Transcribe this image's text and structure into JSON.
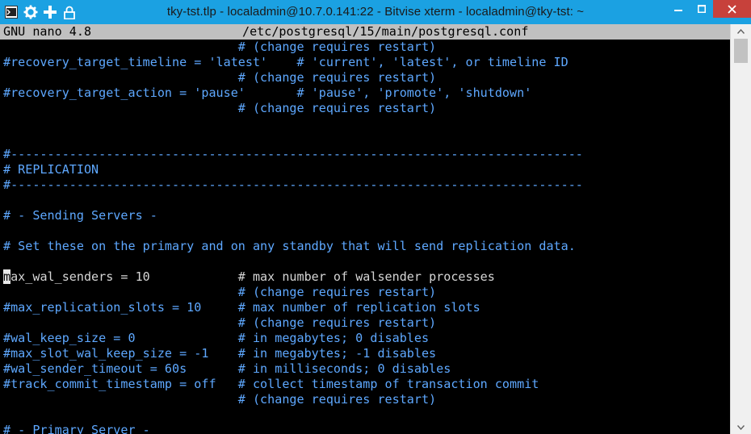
{
  "window": {
    "title": "tky-tst.tlp - localadmin@10.7.0.141:22 - Bitvise xterm - localadmin@tky-tst: ~",
    "icons": [
      "terminal-app-icon",
      "gear-icon",
      "plus-icon",
      "lock-icon"
    ],
    "controls": [
      "minimize",
      "maximize",
      "close"
    ]
  },
  "nano": {
    "version": "GNU nano 4.8",
    "filename": "/etc/postgresql/15/main/postgresql.conf"
  },
  "lines": [
    {
      "text": "                                # (change requires restart)",
      "kind": "comment"
    },
    {
      "text": "#recovery_target_timeline = 'latest'    # 'current', 'latest', or timeline ID",
      "kind": "comment"
    },
    {
      "text": "                                # (change requires restart)",
      "kind": "comment"
    },
    {
      "text": "#recovery_target_action = 'pause'       # 'pause', 'promote', 'shutdown'",
      "kind": "comment"
    },
    {
      "text": "                                # (change requires restart)",
      "kind": "comment"
    },
    {
      "text": "",
      "kind": "blank"
    },
    {
      "text": "",
      "kind": "blank"
    },
    {
      "text": "#------------------------------------------------------------------------------",
      "kind": "comment"
    },
    {
      "text": "# REPLICATION",
      "kind": "comment"
    },
    {
      "text": "#------------------------------------------------------------------------------",
      "kind": "comment"
    },
    {
      "text": "",
      "kind": "blank"
    },
    {
      "text": "# - Sending Servers -",
      "kind": "comment"
    },
    {
      "text": "",
      "kind": "blank"
    },
    {
      "text": "# Set these on the primary and on any standby that will send replication data.",
      "kind": "comment"
    },
    {
      "text": "",
      "kind": "blank"
    },
    {
      "text": "max_wal_senders = 10            # max number of walsender processes",
      "kind": "active"
    },
    {
      "text": "                                # (change requires restart)",
      "kind": "comment"
    },
    {
      "text": "#max_replication_slots = 10     # max number of replication slots",
      "kind": "comment"
    },
    {
      "text": "                                # (change requires restart)",
      "kind": "comment"
    },
    {
      "text": "#wal_keep_size = 0              # in megabytes; 0 disables",
      "kind": "comment"
    },
    {
      "text": "#max_slot_wal_keep_size = -1    # in megabytes; -1 disables",
      "kind": "comment"
    },
    {
      "text": "#wal_sender_timeout = 60s       # in milliseconds; 0 disables",
      "kind": "comment"
    },
    {
      "text": "#track_commit_timestamp = off   # collect timestamp of transaction commit",
      "kind": "comment"
    },
    {
      "text": "                                # (change requires restart)",
      "kind": "comment"
    },
    {
      "text": "",
      "kind": "blank"
    },
    {
      "text": "# - Primary Server -",
      "kind": "comment"
    }
  ],
  "cursor_line": 15,
  "colors": {
    "comment": "#5ea8ff",
    "text": "#d6d6d6",
    "titlebar": "#1ba1e2",
    "close": "#c7413b"
  }
}
